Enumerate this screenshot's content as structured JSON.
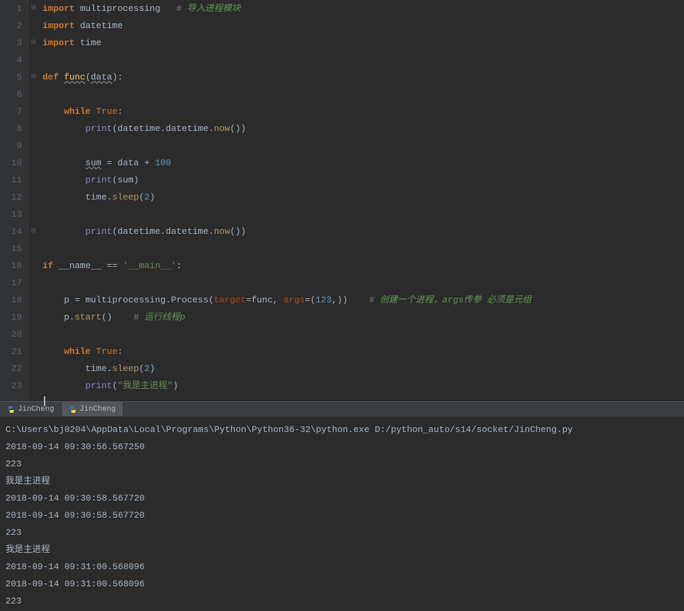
{
  "editor": {
    "lines": [
      "1",
      "2",
      "3",
      "4",
      "5",
      "6",
      "7",
      "8",
      "9",
      "10",
      "11",
      "12",
      "13",
      "14",
      "15",
      "16",
      "17",
      "18",
      "19",
      "20",
      "21",
      "22",
      "23"
    ],
    "line1": {
      "import": "import",
      "mod": "multiprocessing",
      "c1": "# ",
      "c2": "导入进程模块"
    },
    "line2": {
      "import": "import",
      "mod": "datetime"
    },
    "line3": {
      "import": "import",
      "mod": "time"
    },
    "line5": {
      "def": "def",
      "name": "func",
      "arg": "data"
    },
    "line7": {
      "while": "while",
      "true": "True"
    },
    "line8": {
      "print": "print",
      "d1": "datetime",
      "dot": ".",
      "d2": "datetime",
      "now": "now"
    },
    "line10": {
      "sum": "sum",
      "eq": " = ",
      "data": "data",
      "plus": " + ",
      "val": "100"
    },
    "line11": {
      "print": "print",
      "sum": "sum"
    },
    "line12": {
      "time": "time",
      "dot": ".",
      "sleep": "sleep",
      "val": "2"
    },
    "line14": {
      "print": "print",
      "d1": "datetime",
      "dot": ".",
      "d2": "datetime",
      "now": "now"
    },
    "line16": {
      "if": "if",
      "name": "__name__",
      "eq": " == ",
      "str": "'__main__'"
    },
    "line18": {
      "p": "p",
      "eq": " = ",
      "mp": "multiprocessing",
      "dot": ".",
      "proc": "Process",
      "target": "target",
      "eqs": "=",
      "func": "func",
      "comma": ", ",
      "args": "args",
      "val": "123",
      "c1": "# ",
      "c2": "创建一个进程，args传参 必须是元组"
    },
    "line19": {
      "p": "p",
      "dot": ".",
      "start": "start",
      "c1": "# ",
      "c2": "运行线程p"
    },
    "line21": {
      "while": "while",
      "true": "True"
    },
    "line22": {
      "time": "time",
      "dot": ".",
      "sleep": "sleep",
      "val": "2"
    },
    "line23": {
      "print": "print",
      "str": "\"我是主进程\""
    }
  },
  "tabs": {
    "t1": "JinCheng",
    "t2": "JinCheng"
  },
  "console": {
    "l1": "C:\\Users\\bj0204\\AppData\\Local\\Programs\\Python\\Python36-32\\python.exe D:/python_auto/s14/socket/JinCheng.py",
    "l2": "2018-09-14 09:30:56.567250",
    "l3": "223",
    "l4": "我是主进程",
    "l5": "2018-09-14 09:30:58.567720",
    "l6": "2018-09-14 09:30:58.567720",
    "l7": "223",
    "l8": "我是主进程",
    "l9": "2018-09-14 09:31:00.568096",
    "l10": "2018-09-14 09:31:00.568096",
    "l11": "223"
  }
}
